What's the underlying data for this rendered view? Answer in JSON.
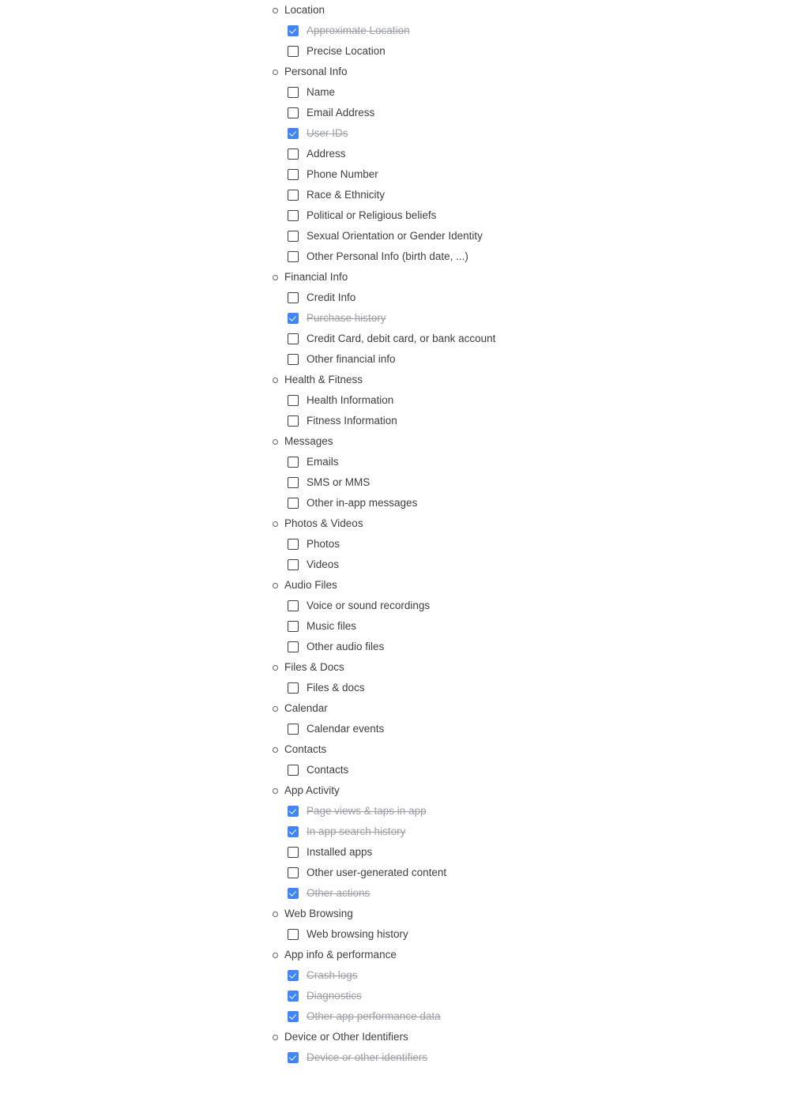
{
  "colors": {
    "checked_blue": "#4285F4",
    "checkbox_border": "#3C4043",
    "label_text": "#3C4043",
    "checked_label_text": "#9AA0A6",
    "background": "#FFFFFF"
  },
  "tree": {
    "sections": [
      {
        "label": "Location",
        "items": [
          {
            "label": "Approximate Location",
            "checked": true
          },
          {
            "label": "Precise Location",
            "checked": false
          }
        ]
      },
      {
        "label": "Personal Info",
        "items": [
          {
            "label": "Name",
            "checked": false
          },
          {
            "label": "Email Address",
            "checked": false
          },
          {
            "label": "User IDs",
            "checked": true
          },
          {
            "label": "Address",
            "checked": false
          },
          {
            "label": "Phone Number",
            "checked": false
          },
          {
            "label": "Race & Ethnicity",
            "checked": false
          },
          {
            "label": "Political or Religious beliefs",
            "checked": false
          },
          {
            "label": "Sexual Orientation or Gender Identity",
            "checked": false
          },
          {
            "label": "Other Personal Info (birth date, ...)",
            "checked": false
          }
        ]
      },
      {
        "label": "Financial Info",
        "items": [
          {
            "label": "Credit Info",
            "checked": false
          },
          {
            "label": "Purchase history",
            "checked": true
          },
          {
            "label": "Credit Card, debit card, or bank account",
            "checked": false
          },
          {
            "label": "Other financial info",
            "checked": false
          }
        ]
      },
      {
        "label": "Health & Fitness",
        "items": [
          {
            "label": "Health Information",
            "checked": false
          },
          {
            "label": "Fitness Information",
            "checked": false
          }
        ]
      },
      {
        "label": "Messages",
        "items": [
          {
            "label": "Emails",
            "checked": false
          },
          {
            "label": "SMS or MMS",
            "checked": false
          },
          {
            "label": "Other in-app messages",
            "checked": false
          }
        ]
      },
      {
        "label": "Photos & Videos",
        "items": [
          {
            "label": "Photos",
            "checked": false
          },
          {
            "label": "Videos",
            "checked": false
          }
        ]
      },
      {
        "label": "Audio Files",
        "items": [
          {
            "label": "Voice or sound recordings",
            "checked": false
          },
          {
            "label": "Music files",
            "checked": false
          },
          {
            "label": "Other audio files",
            "checked": false
          }
        ]
      },
      {
        "label": "Files & Docs",
        "items": [
          {
            "label": "Files & docs",
            "checked": false
          }
        ]
      },
      {
        "label": "Calendar",
        "items": [
          {
            "label": "Calendar events",
            "checked": false
          }
        ]
      },
      {
        "label": "Contacts",
        "items": [
          {
            "label": "Contacts",
            "checked": false
          }
        ]
      },
      {
        "label": "App Activity",
        "items": [
          {
            "label": "Page views & taps in app",
            "checked": true
          },
          {
            "label": "In app search history",
            "checked": true
          },
          {
            "label": "Installed apps",
            "checked": false
          },
          {
            "label": "Other user-generated content",
            "checked": false
          },
          {
            "label": "Other actions",
            "checked": true
          }
        ]
      },
      {
        "label": "Web Browsing",
        "items": [
          {
            "label": "Web browsing history",
            "checked": false
          }
        ]
      },
      {
        "label": "App info & performance",
        "items": [
          {
            "label": "Crash logs",
            "checked": true
          },
          {
            "label": "Diagnostics",
            "checked": true
          },
          {
            "label": "Other app performance data",
            "checked": true
          }
        ]
      },
      {
        "label": "Device or Other Identifiers",
        "items": [
          {
            "label": "Device or other identifiers",
            "checked": true
          }
        ]
      }
    ]
  }
}
